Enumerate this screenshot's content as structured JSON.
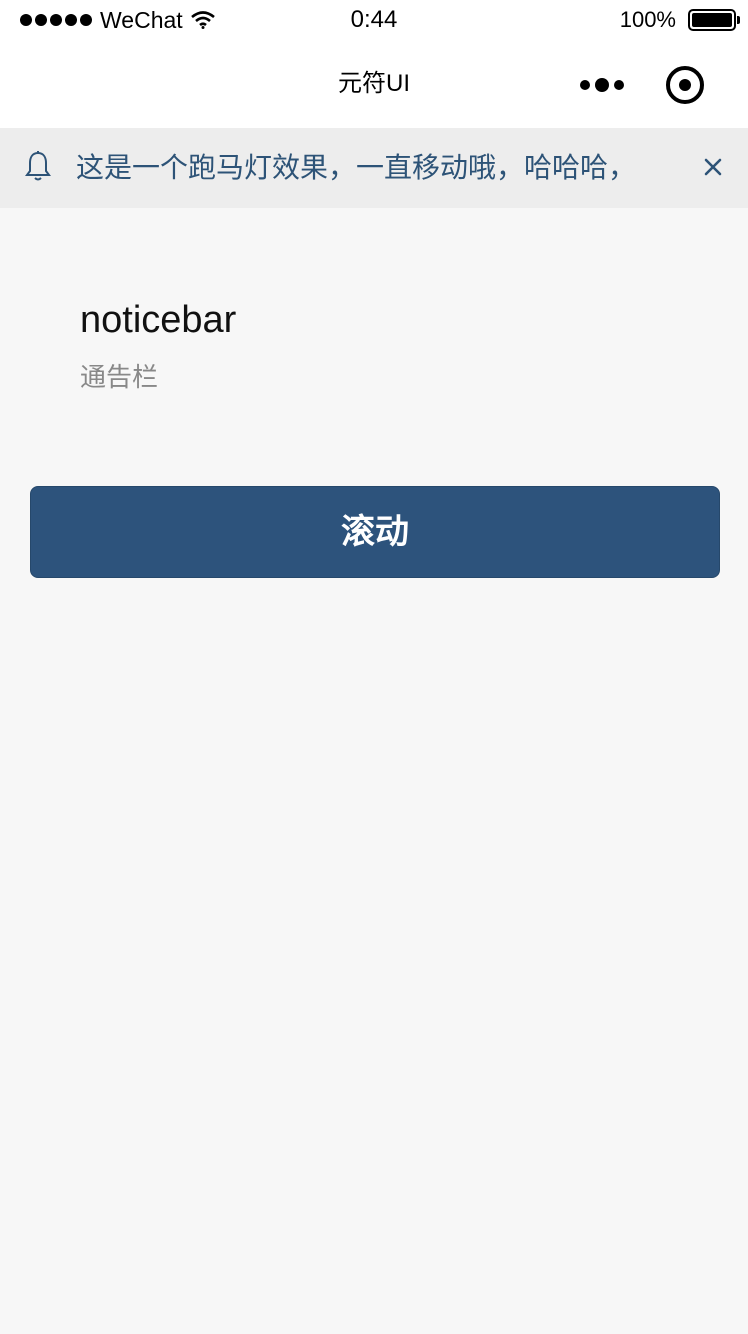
{
  "status_bar": {
    "carrier": "WeChat",
    "time": "0:44",
    "battery": "100%"
  },
  "nav": {
    "title": "元符UI"
  },
  "noticebar": {
    "text": "这是一个跑马灯效果，一直移动哦，哈哈哈，",
    "color": "#2d5377"
  },
  "intro": {
    "title": "noticebar",
    "subtitle": "通告栏"
  },
  "actions": {
    "scroll_label": "滚动",
    "accent": "#2d537c"
  }
}
